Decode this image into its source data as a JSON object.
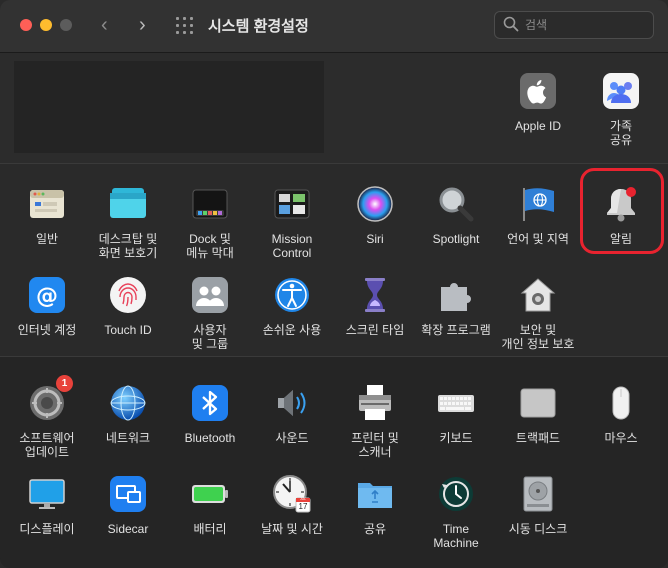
{
  "window": {
    "title": "시스템 환경설정",
    "search_placeholder": "검색",
    "nav_back": "‹",
    "nav_forward": "›"
  },
  "account": {
    "apple_id_label": "Apple ID",
    "family_label": "가족\n공유"
  },
  "row1": [
    {
      "label": "일반",
      "icon": "general-icon"
    },
    {
      "label": "데스크탑 및\n화면 보호기",
      "icon": "desktop-screensaver-icon"
    },
    {
      "label": "Dock 및\n메뉴 막대",
      "icon": "dock-icon"
    },
    {
      "label": "Mission\nControl",
      "icon": "mission-control-icon"
    },
    {
      "label": "Siri",
      "icon": "siri-icon"
    },
    {
      "label": "Spotlight",
      "icon": "spotlight-icon"
    },
    {
      "label": "언어 및 지역",
      "icon": "language-region-icon"
    },
    {
      "label": "알림",
      "icon": "notifications-icon"
    }
  ],
  "row2": [
    {
      "label": "인터넷 계정",
      "icon": "internet-accounts-icon"
    },
    {
      "label": "Touch ID",
      "icon": "touch-id-icon"
    },
    {
      "label": "사용자\n및 그룹",
      "icon": "users-groups-icon"
    },
    {
      "label": "손쉬운 사용",
      "icon": "accessibility-icon"
    },
    {
      "label": "스크린 타임",
      "icon": "screen-time-icon"
    },
    {
      "label": "확장 프로그램",
      "icon": "extensions-icon"
    },
    {
      "label": "보안 및\n개인 정보 보호",
      "icon": "security-privacy-icon"
    }
  ],
  "row3": [
    {
      "label": "소프트웨어\n업데이트",
      "icon": "software-update-icon",
      "badge": "1"
    },
    {
      "label": "네트워크",
      "icon": "network-icon"
    },
    {
      "label": "Bluetooth",
      "icon": "bluetooth-icon"
    },
    {
      "label": "사운드",
      "icon": "sound-icon"
    },
    {
      "label": "프린터 및\n스캐너",
      "icon": "printer-scanner-icon"
    },
    {
      "label": "키보드",
      "icon": "keyboard-icon"
    },
    {
      "label": "트랙패드",
      "icon": "trackpad-icon"
    },
    {
      "label": "마우스",
      "icon": "mouse-icon"
    }
  ],
  "row4": [
    {
      "label": "디스플레이",
      "icon": "displays-icon"
    },
    {
      "label": "Sidecar",
      "icon": "sidecar-icon"
    },
    {
      "label": "배터리",
      "icon": "battery-icon"
    },
    {
      "label": "날짜 및 시간",
      "icon": "date-time-icon",
      "calendar_day": "17",
      "calendar_month": "JUL"
    },
    {
      "label": "공유",
      "icon": "sharing-icon"
    },
    {
      "label": "Time\nMachine",
      "icon": "time-machine-icon"
    },
    {
      "label": "시동 디스크",
      "icon": "startup-disk-icon"
    }
  ]
}
